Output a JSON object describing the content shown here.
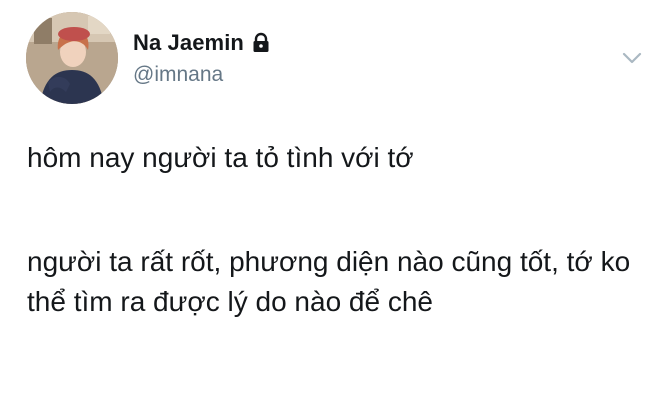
{
  "tweet": {
    "author": {
      "display_name": "Na Jaemin",
      "handle": "@imnana",
      "protected_icon": "lock-icon",
      "avatar": "profile-photo"
    },
    "menu_icon": "chevron-down-icon",
    "paragraphs": [
      "hôm nay người ta tỏ tình với tớ",
      "người ta rất rốt, phương diện nào cũng tốt, tớ ko thể tìm ra được lý do nào để chê"
    ]
  },
  "colors": {
    "text_primary": "#14171a",
    "text_secondary": "#657786",
    "caret": "#aab8c2",
    "background": "#ffffff"
  }
}
